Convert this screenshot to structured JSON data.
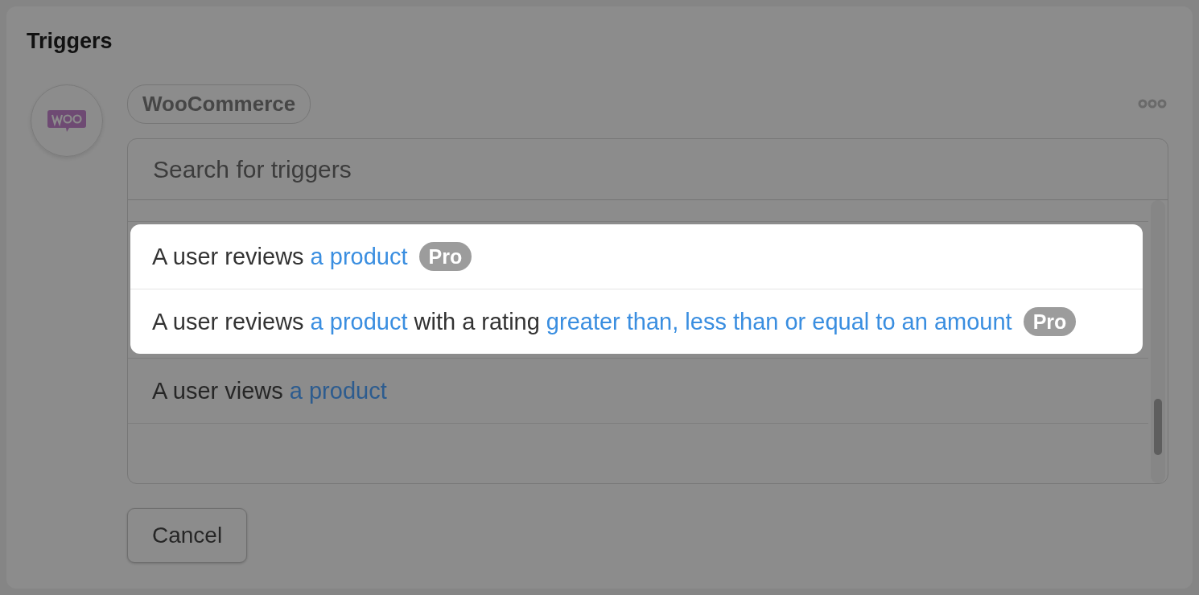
{
  "title": "Triggers",
  "integration": {
    "name": "WooCommerce"
  },
  "search": {
    "placeholder": "Search for triggers"
  },
  "triggers": [
    {
      "highlighted": true,
      "badge": "Pro",
      "parts": [
        {
          "text": "A user reviews",
          "link": false
        },
        {
          "text": "a product",
          "link": true
        }
      ]
    },
    {
      "highlighted": true,
      "badge": "Pro",
      "parts": [
        {
          "text": "A user reviews",
          "link": false
        },
        {
          "text": "a product",
          "link": true
        },
        {
          "text": "with a rating",
          "link": false
        },
        {
          "text": "greater than, less than or equal to an amount",
          "link": true
        }
      ]
    },
    {
      "highlighted": false,
      "parts": [
        {
          "text": "A user views",
          "link": false
        },
        {
          "text": "a product",
          "link": true
        }
      ]
    }
  ],
  "buttons": [
    {
      "label": "Cancel"
    }
  ]
}
